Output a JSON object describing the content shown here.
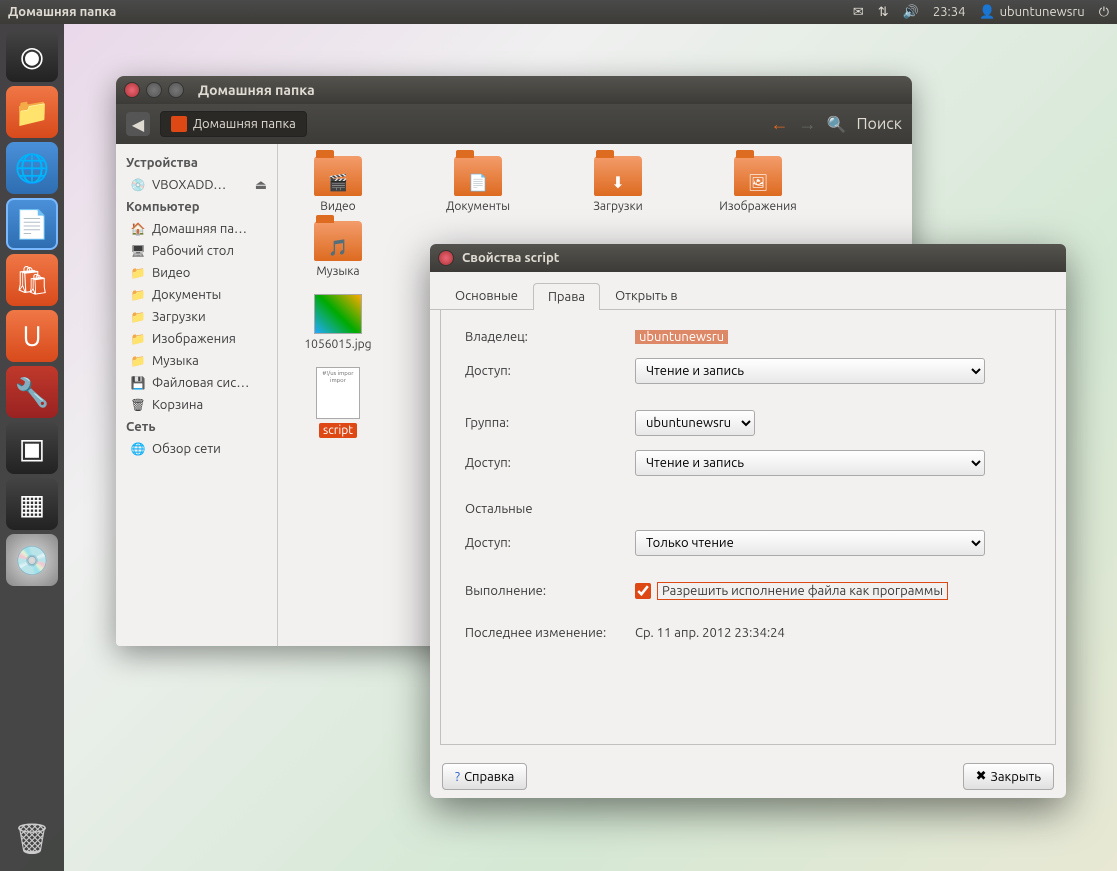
{
  "topPanel": {
    "title": "Домашняя папка",
    "time": "23:34",
    "user": "ubuntunewsru"
  },
  "nautilus": {
    "title": "Домашняя папка",
    "breadcrumb": "Домашняя папка",
    "search": "Поиск",
    "sidebar": {
      "devices": "Устройства",
      "vbox": "VBOXADD…",
      "computer": "Компьютер",
      "home": "Домашняя па…",
      "desktop": "Рабочий стол",
      "video": "Видео",
      "documents": "Документы",
      "downloads": "Загрузки",
      "pictures": "Изображения",
      "music": "Музыка",
      "filesystem": "Файловая сис…",
      "trash": "Корзина",
      "network": "Сеть",
      "browse": "Обзор сети"
    },
    "files": {
      "video": "Видео",
      "documents": "Документы",
      "downloads": "Загрузки",
      "pictures": "Изображения",
      "music": "Музыка",
      "imgfile": "1056015.jpg",
      "script": "script",
      "scriptContent": "#!/us\nimpor\nimpor"
    }
  },
  "dialog": {
    "title": "Свойства script",
    "tabs": {
      "basic": "Основные",
      "perms": "Права",
      "openwith": "Открыть в"
    },
    "owner": "Владелец:",
    "ownerVal": "ubuntunewsru",
    "access": "Доступ:",
    "rw": "Чтение и запись",
    "group": "Группа:",
    "groupVal": "ubuntunewsru",
    "others": "Остальные",
    "ro": "Только чтение",
    "exec": "Выполнение:",
    "execLabel": "Разрешить исполнение файла как программы",
    "modified": "Последнее изменение:",
    "modifiedVal": "Ср. 11 апр. 2012 23:34:24",
    "help": "Справка",
    "close": "Закрыть"
  }
}
